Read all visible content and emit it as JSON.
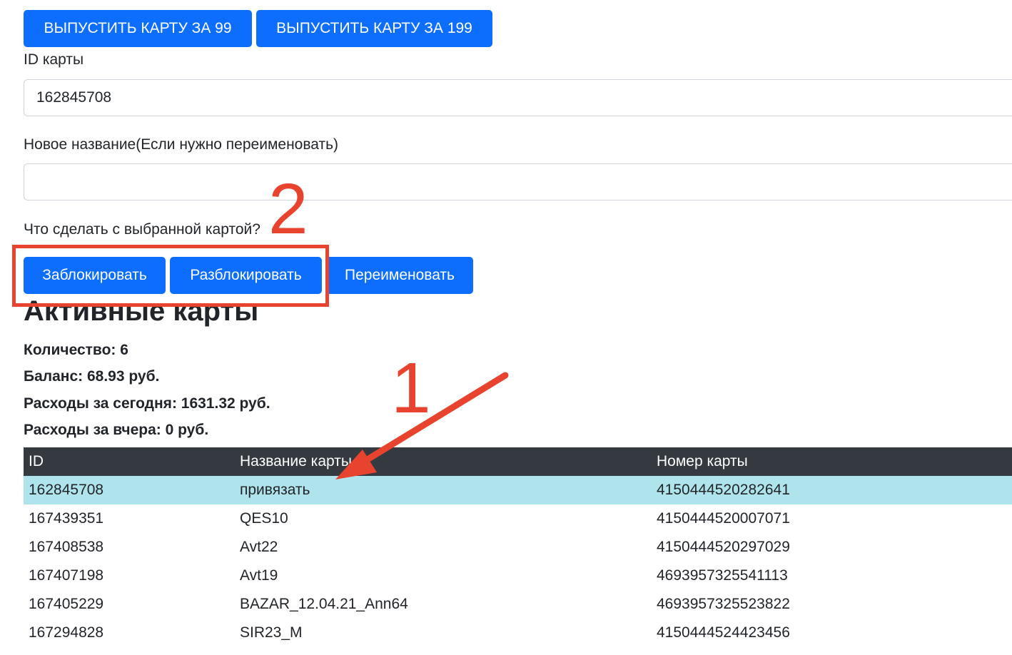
{
  "buttons": {
    "issue_99": "ВЫПУСТИТЬ КАРТУ ЗА 99",
    "issue_199": "ВЫПУСТИТЬ КАРТУ ЗА 199"
  },
  "form": {
    "card_id_label": "ID карты",
    "card_id_value": "162845708",
    "new_name_label": "Новое название(Если нужно переименовать)",
    "new_name_value": "",
    "action_label": "Что сделать с выбранной картой?",
    "actions": {
      "block": "Заблокировать",
      "unblock": "Разблокировать",
      "rename": "Переименовать"
    }
  },
  "section": {
    "title": "Активные карты",
    "count": "Количество: 6",
    "balance": "Баланс: 68.93 руб.",
    "spent_today": "Расходы за сегодня: 1631.32 руб.",
    "spent_yesterday": "Расходы за вчера: 0 руб."
  },
  "table": {
    "headers": [
      "ID",
      "Название карты",
      "Номер карты"
    ],
    "rows": [
      {
        "id": "162845708",
        "name": "привязать",
        "number": "4150444520282641"
      },
      {
        "id": "167439351",
        "name": "QES10",
        "number": "4150444520007071"
      },
      {
        "id": "167408538",
        "name": "Avt22",
        "number": "4150444520297029"
      },
      {
        "id": "167407198",
        "name": "Avt19",
        "number": "4693957325541113"
      },
      {
        "id": "167405229",
        "name": "BAZAR_12.04.21_Ann64",
        "number": "4693957325523822"
      },
      {
        "id": "167294828",
        "name": "SIR23_M",
        "number": "4150444524423456"
      }
    ]
  },
  "annotations": {
    "step_1": "1",
    "step_2": "2",
    "color": "#e8432f"
  },
  "colors": {
    "primary": "#0d6efd",
    "table_header": "#343a40",
    "active_row": "#b0e4ec"
  }
}
